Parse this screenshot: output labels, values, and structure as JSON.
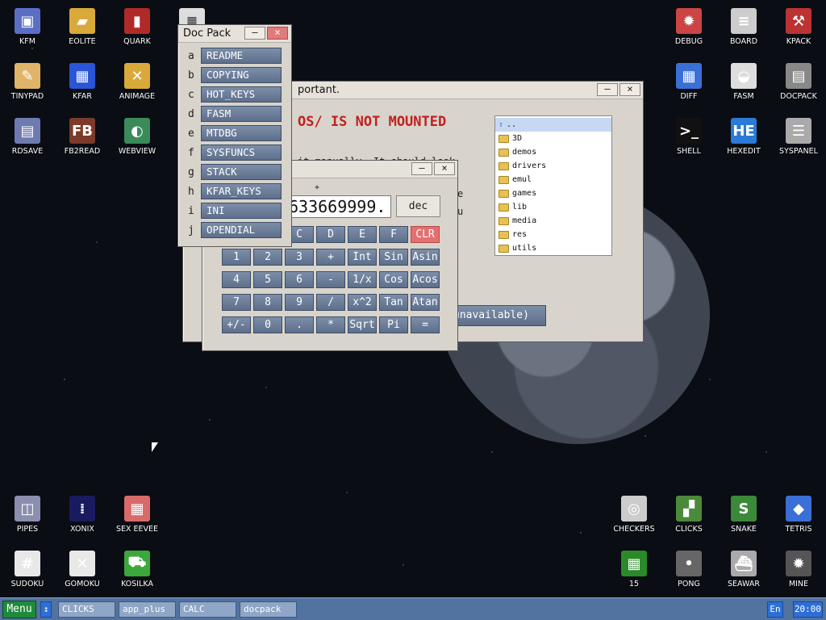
{
  "desktop": {
    "icons_left": [
      {
        "label": "KFM",
        "icon": "floppy-icon",
        "color": "#5a6fc4"
      },
      {
        "label": "EOLITE",
        "icon": "folder-icon",
        "color": "#d9a93a"
      },
      {
        "label": "QUARK",
        "icon": "notebook-icon",
        "color": "#b12a2a"
      },
      {
        "label": "TINYPAD",
        "icon": "pad-icon",
        "color": "#e0b56a"
      },
      {
        "label": "KFAR",
        "icon": "archive-icon",
        "color": "#2a55d6"
      },
      {
        "label": "ANIMAGE",
        "icon": "brush-icon",
        "color": "#d9a93a"
      },
      {
        "label": "RDSAVE",
        "icon": "save-icon",
        "color": "#6e7bb0"
      },
      {
        "label": "FB2READ",
        "icon": "book-icon",
        "color": "#7b3b2a"
      },
      {
        "label": "WEBVIEW",
        "icon": "globe-icon",
        "color": "#3a8a5a"
      }
    ],
    "icons_right": [
      {
        "label": "DEBUG",
        "icon": "bug-icon",
        "color": "#c44"
      },
      {
        "label": "BOARD",
        "icon": "board-icon",
        "color": "#ccc"
      },
      {
        "label": "KPACK",
        "icon": "hammer-icon",
        "color": "#b33"
      },
      {
        "label": "DIFF",
        "icon": "diff-icon",
        "color": "#3a6fd6"
      },
      {
        "label": "FASM",
        "icon": "fasm-icon",
        "color": "#ddd"
      },
      {
        "label": "DOCPACK",
        "icon": "cabinet-icon",
        "color": "#888"
      },
      {
        "label": "SHELL",
        "icon": "terminal-icon",
        "color": "#111"
      },
      {
        "label": "HEXEDIT",
        "icon": "hex-icon",
        "color": "#2a7ad6"
      },
      {
        "label": "SYSPANEL",
        "icon": "sliders-icon",
        "color": "#aaa"
      }
    ],
    "icons_bottom_left": [
      {
        "label": "PIPES",
        "icon": "pipes-icon",
        "color": "#8a8fb0"
      },
      {
        "label": "XONIX",
        "icon": "xonix-icon",
        "color": "#1a1a60"
      },
      {
        "label": "SEX EEVEE",
        "icon": "tiles-icon",
        "color": "#d96a6a"
      },
      {
        "label": "SUDOKU",
        "icon": "sudoku-icon",
        "color": "#e8e8e8"
      },
      {
        "label": "GOMOKU",
        "icon": "gomoku-icon",
        "color": "#e8e8e8"
      },
      {
        "label": "KOSILKA",
        "icon": "mower-icon",
        "color": "#3aa83a"
      }
    ],
    "icons_bottom_right": [
      {
        "label": "CHECKERS",
        "icon": "checkers-icon",
        "color": "#ccc"
      },
      {
        "label": "CLICKS",
        "icon": "clicks-icon",
        "color": "#4a8a3a"
      },
      {
        "label": "SNAKE",
        "icon": "snake-icon",
        "color": "#3a8a3a"
      },
      {
        "label": "TETRIS",
        "icon": "tetris-icon",
        "color": "#3a6fd6"
      },
      {
        "label": "15",
        "icon": "fifteen-icon",
        "color": "#2a8a2a"
      },
      {
        "label": "PONG",
        "icon": "pong-icon",
        "color": "#666"
      },
      {
        "label": "SEAWAR",
        "icon": "ship-icon",
        "color": "#aaa"
      },
      {
        "label": "MINE",
        "icon": "mine-icon",
        "color": "#555"
      }
    ]
  },
  "docpack": {
    "title": "Doc Pack",
    "items": [
      {
        "key": "a",
        "label": "README"
      },
      {
        "key": "b",
        "label": "COPYING"
      },
      {
        "key": "c",
        "label": "HOT_KEYS"
      },
      {
        "key": "d",
        "label": "FASM"
      },
      {
        "key": "e",
        "label": "MTDBG"
      },
      {
        "key": "f",
        "label": "SYSFUNCS"
      },
      {
        "key": "g",
        "label": "STACK"
      },
      {
        "key": "h",
        "label": "KFAR_KEYS"
      },
      {
        "key": "i",
        "label": "INI"
      },
      {
        "key": "j",
        "label": "OPENDIAL"
      }
    ]
  },
  "notice": {
    "title_visible": "portant.",
    "heading_visible": "OS/ IS NOT MOUNTED",
    "body_fragment": "it manually. It should look",
    "side_fragments": [
      "e",
      "u"
    ],
    "button_label_visible": "unavailable)",
    "files": [
      "..",
      "3D",
      "demos",
      "drivers",
      "emul",
      "games",
      "lib",
      "media",
      "res",
      "utils"
    ]
  },
  "calc": {
    "display": "633669999.",
    "mode_button": "dec",
    "plus_marker": "+",
    "top_row": [
      "C",
      "D",
      "E",
      "F",
      "CLR"
    ],
    "rows": [
      [
        "1",
        "2",
        "3",
        "+",
        "Int",
        "Sin",
        "Asin"
      ],
      [
        "4",
        "5",
        "6",
        "-",
        "1/x",
        "Cos",
        "Acos"
      ],
      [
        "7",
        "8",
        "9",
        "/",
        "x^2",
        "Tan",
        "Atan"
      ],
      [
        "+/-",
        "0",
        ".",
        "*",
        "Sqrt",
        "Pi",
        "="
      ]
    ]
  },
  "taskbar": {
    "menu_label": "Menu",
    "items": [
      "CLICKS",
      "app_plus",
      "CALC",
      "docpack"
    ],
    "lang": "En",
    "clock": "20:00"
  }
}
